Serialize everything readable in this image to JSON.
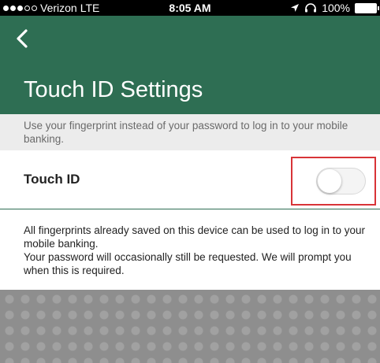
{
  "status_bar": {
    "carrier": "Verizon",
    "network": "LTE",
    "time": "8:05 AM",
    "battery": "100%",
    "signal_bars_filled": 3,
    "signal_bars_total": 5
  },
  "header": {
    "title": "Touch ID Settings",
    "back_icon": "chevron-left-icon",
    "background_color": "#2e6e53"
  },
  "description": "Use your fingerprint instead of your password to log in to your mobile banking.",
  "touch_id": {
    "label": "Touch ID",
    "enabled": false,
    "highlight_color": "#d83438"
  },
  "info": {
    "line1": "All fingerprints already saved on this device can be used to log in to your mobile banking.",
    "line2": "Your password will occasionally still be requested. We will prompt you when this is required."
  }
}
